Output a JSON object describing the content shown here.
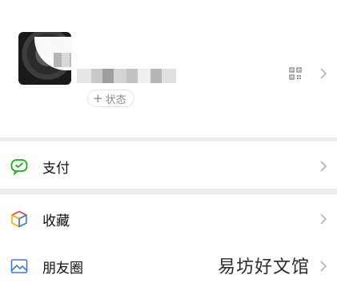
{
  "profile": {
    "status_button_plus": "+",
    "status_button_label": "状态"
  },
  "menu": {
    "items": [
      {
        "label": "支付",
        "icon": "wechat-pay-icon"
      },
      {
        "label": "收藏",
        "icon": "favorites-cube-icon"
      },
      {
        "label": "朋友圈",
        "icon": "moments-picture-icon"
      }
    ]
  },
  "watermark": "易坊好文馆",
  "colors": {
    "pay_green": "#1aad19",
    "separator": "#ededed",
    "chevron": "#b2b2b2",
    "moments_blue": "#3a7bd5"
  }
}
